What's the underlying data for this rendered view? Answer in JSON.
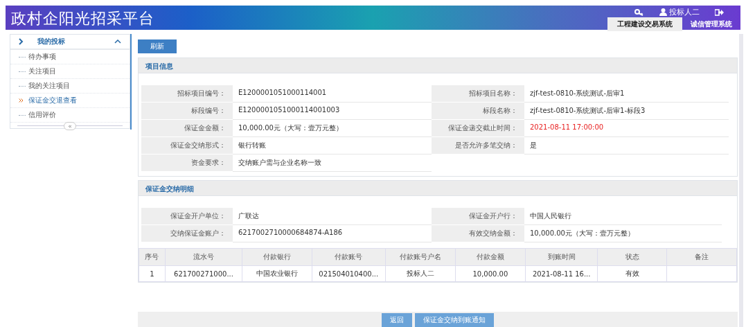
{
  "header": {
    "title": "政村企阳光招采平台",
    "user": "投标人二",
    "tabs": [
      {
        "label": "工程建设交易系统",
        "selected": true
      },
      {
        "label": "诚信管理系统",
        "selected": false
      }
    ]
  },
  "sidebar": {
    "group": {
      "label": "我的投标",
      "expanded": true
    },
    "items": [
      {
        "label": "待办事项",
        "selected": false
      },
      {
        "label": "关注项目",
        "selected": false
      },
      {
        "label": "我的关注项目",
        "selected": false
      },
      {
        "label": "保证金交退查看",
        "selected": true
      },
      {
        "label": "信用评价",
        "selected": false
      }
    ],
    "collapse": "«"
  },
  "refresh_button": "刷新",
  "project_info": {
    "title": "项目信息",
    "fields": [
      {
        "label": "招标项目编号：",
        "value": "E1200001051000114001",
        "alert": false
      },
      {
        "label": "招标项目名称：",
        "value": "zjf-test-0810-系统测试-后审1",
        "alert": false
      },
      {
        "label": "标段编号：",
        "value": "E1200001051000114001003",
        "alert": false
      },
      {
        "label": "标段名称：",
        "value": "zjf-test-0810-系统测试-后审1-标段3",
        "alert": false
      },
      {
        "label": "保证金金额：",
        "value": "10,000.00元（大写：壹万元整）",
        "alert": false
      },
      {
        "label": "保证金递交截止时间：",
        "value": "2021-08-11 17:00:00",
        "alert": true
      },
      {
        "label": "保证金交纳形式：",
        "value": "银行转账",
        "alert": false
      },
      {
        "label": "是否允许多笔交纳：",
        "value": "是",
        "alert": false
      },
      {
        "label": "资金要求：",
        "value": "交纳账户需与企业名称一致",
        "alert": false
      }
    ]
  },
  "deposit_details": {
    "title": "保证金交纳明细",
    "fields": [
      {
        "label": "保证金开户单位：",
        "value": "广联达"
      },
      {
        "label": "保证金开户行：",
        "value": "中国人民银行"
      },
      {
        "label": "交纳保证金账户：",
        "value": "6217002710000684874-A186"
      },
      {
        "label": "有效交纳金额：",
        "value": "10,000.00元（大写：壹万元整）"
      }
    ],
    "table": {
      "columns": [
        "序号",
        "流水号",
        "付款银行",
        "付款账号",
        "付款账号户名",
        "付款金额",
        "到账时间",
        "状态",
        "备注"
      ],
      "rows": [
        [
          "1",
          "621700271000...",
          "中国农业银行",
          "021504010400...",
          "投标人二",
          "10,000.00",
          "2021-08-11 16...",
          "有效",
          ""
        ]
      ]
    }
  },
  "footer_buttons": [
    "返回",
    "保证金交纳到账通知"
  ]
}
